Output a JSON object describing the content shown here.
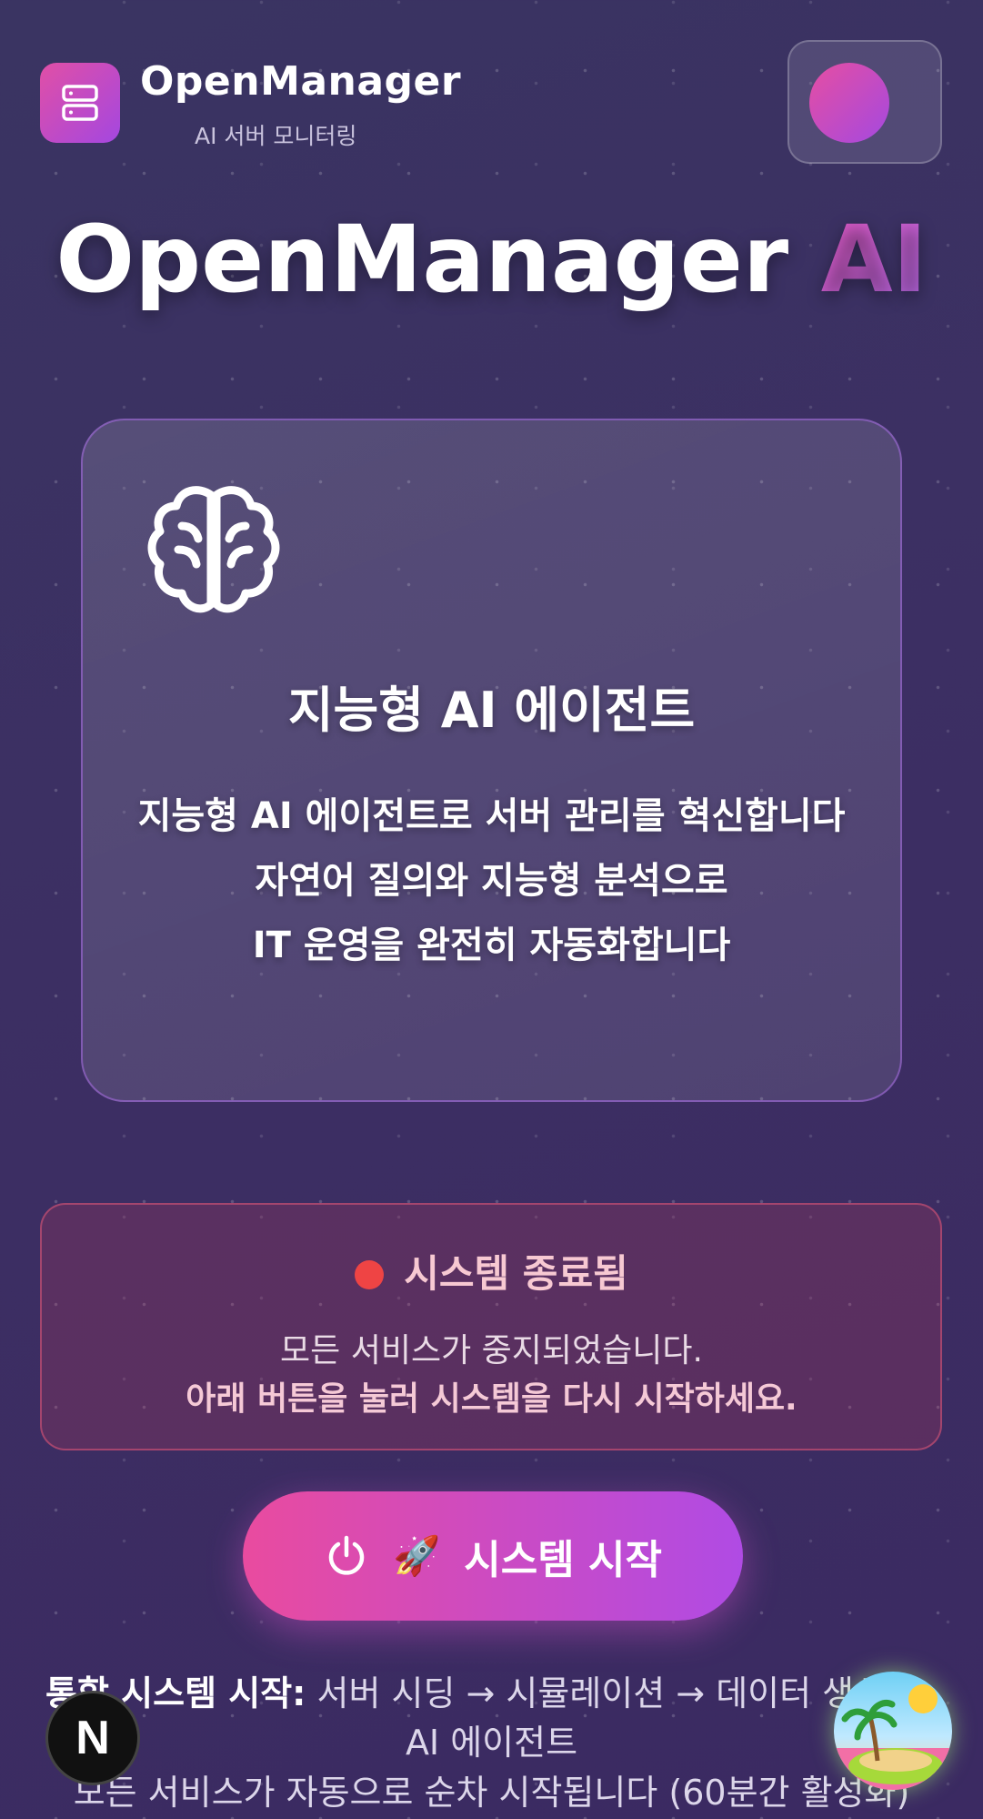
{
  "header": {
    "app_name": "OpenManager",
    "app_subtitle": "AI 서버 모니터링",
    "logo_icon": "server-stack-icon"
  },
  "hero": {
    "title_main": "OpenManager",
    "title_accent": "AI"
  },
  "feature_card": {
    "icon": "brain-icon",
    "title": "지능형 AI 에이전트",
    "desc_line1": "지능형 AI 에이전트로 서버 관리를 혁신합니다",
    "desc_line2": "자연어 질의와 지능형 분석으로",
    "desc_line3": "IT 운영을 완전히 자동화합니다"
  },
  "status": {
    "title": "시스템 종료됨",
    "line1": "모든 서비스가 중지되었습니다.",
    "line2": "아래 버튼을 눌러 시스템을 다시 시작하세요.",
    "dot_color": "#ef4444"
  },
  "start_button": {
    "label": "시스템 시작",
    "emoji": "🚀"
  },
  "footer": {
    "bold_label": "통합 시스템 시작:",
    "flow": "서버 시딩 → 시뮬레이션 → 데이터 생성 →",
    "line2": "AI 에이전트",
    "line3": "모든 서비스가 자동으로 순차 시작됩니다 (60분간 활성화)"
  },
  "floating": {
    "next_badge_label": "N"
  },
  "colors": {
    "accent_pink": "#e94b9f",
    "accent_purple": "#b04be4",
    "background": "#3b2f63"
  }
}
